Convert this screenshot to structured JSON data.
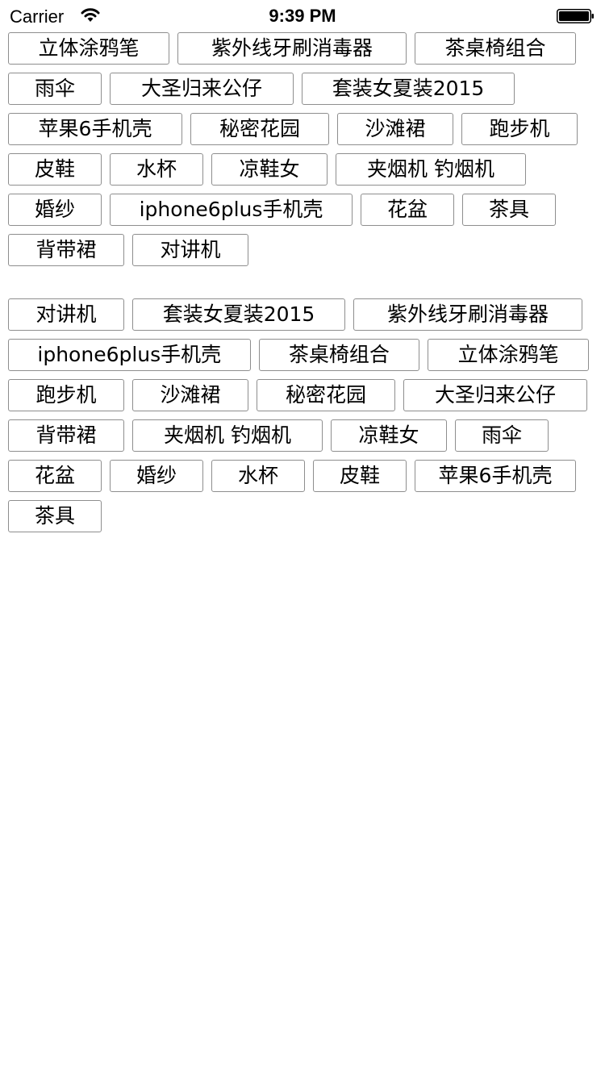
{
  "status_bar": {
    "carrier": "Carrier",
    "time": "9:39 PM",
    "wifi_icon": "wifi-icon",
    "battery_icon": "battery-icon"
  },
  "tag_groups": [
    {
      "rows": [
        [
          "立体涂鸦笔",
          "紫外线牙刷消毒器",
          "茶桌椅组合"
        ],
        [
          "雨伞",
          "大圣归来公仔",
          "套装女夏装2015"
        ],
        [
          "苹果6手机壳",
          "秘密花园",
          "沙滩裙",
          "跑步机"
        ],
        [
          "皮鞋",
          "水杯",
          "凉鞋女",
          "夹烟机 钓烟机"
        ],
        [
          "婚纱",
          "iphone6plus手机壳",
          "花盆",
          "茶具"
        ],
        [
          "背带裙",
          "对讲机"
        ]
      ]
    },
    {
      "rows": [
        [
          "对讲机",
          "套装女夏装2015",
          "紫外线牙刷消毒器"
        ],
        [
          "iphone6plus手机壳",
          "茶桌椅组合",
          "立体涂鸦笔"
        ],
        [
          "跑步机",
          "沙滩裙",
          "秘密花园",
          "大圣归来公仔"
        ],
        [
          "背带裙",
          "夹烟机 钓烟机",
          "凉鞋女",
          "雨伞"
        ],
        [
          "花盆",
          "婚纱",
          "水杯",
          "皮鞋",
          "苹果6手机壳"
        ],
        [
          "茶具"
        ]
      ]
    }
  ],
  "colors": {
    "tag_border": "#8e8e8e",
    "background": "#ffffff",
    "text": "#000000"
  }
}
